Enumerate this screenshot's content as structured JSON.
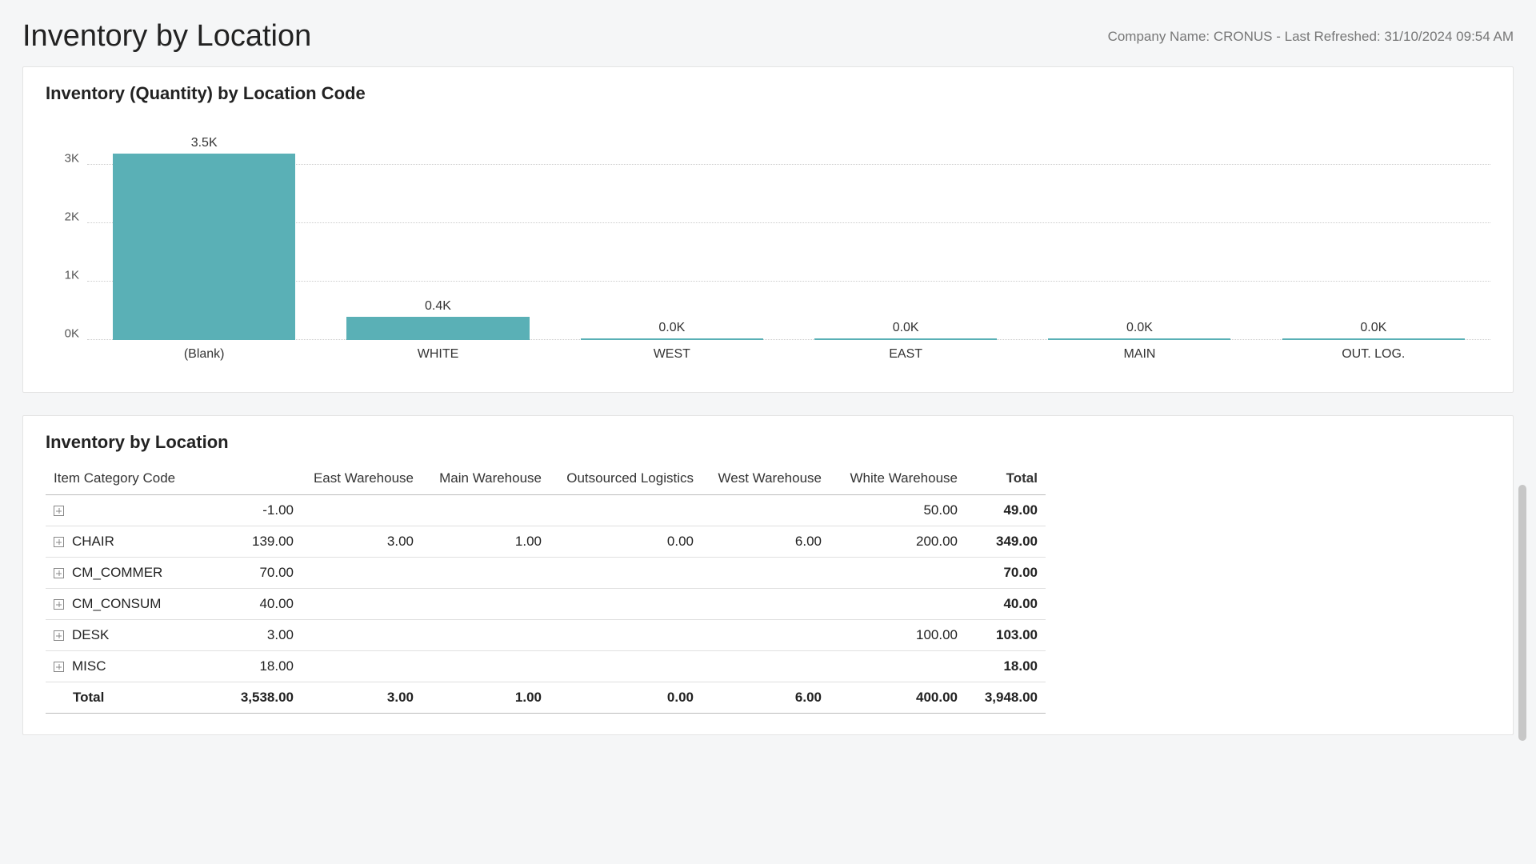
{
  "header": {
    "title": "Inventory by Location",
    "company_line": "Company Name: CRONUS - Last Refreshed: 31/10/2024 09:54 AM"
  },
  "chart": {
    "title": "Inventory (Quantity) by Location Code",
    "y_ticks": [
      "0K",
      "1K",
      "2K",
      "3K"
    ]
  },
  "chart_data": {
    "type": "bar",
    "title": "Inventory (Quantity) by Location Code",
    "xlabel": "",
    "ylabel": "",
    "ylim": [
      0,
      3500
    ],
    "y_ticks": [
      0,
      1000,
      2000,
      3000
    ],
    "categories": [
      "(Blank)",
      "WHITE",
      "WEST",
      "EAST",
      "MAIN",
      "OUT. LOG."
    ],
    "values": [
      3500,
      400,
      0,
      0,
      0,
      0
    ],
    "value_labels": [
      "3.5K",
      "0.4K",
      "0.0K",
      "0.0K",
      "0.0K",
      "0.0K"
    ]
  },
  "matrix": {
    "title": "Inventory by Location",
    "columns": [
      "Item Category Code",
      "",
      "East Warehouse",
      "Main Warehouse",
      "Outsourced Logistics",
      "West Warehouse",
      "White Warehouse",
      "Total"
    ],
    "rows": [
      {
        "code": "",
        "blank": "-1.00",
        "east": "",
        "main": "",
        "out": "",
        "west": "",
        "white": "50.00",
        "total": "49.00"
      },
      {
        "code": "CHAIR",
        "blank": "139.00",
        "east": "3.00",
        "main": "1.00",
        "out": "0.00",
        "west": "6.00",
        "white": "200.00",
        "total": "349.00"
      },
      {
        "code": "CM_COMMER",
        "blank": "70.00",
        "east": "",
        "main": "",
        "out": "",
        "west": "",
        "white": "",
        "total": "70.00"
      },
      {
        "code": "CM_CONSUM",
        "blank": "40.00",
        "east": "",
        "main": "",
        "out": "",
        "west": "",
        "white": "",
        "total": "40.00"
      },
      {
        "code": "DESK",
        "blank": "3.00",
        "east": "",
        "main": "",
        "out": "",
        "west": "",
        "white": "100.00",
        "total": "103.00"
      },
      {
        "code": "MISC",
        "blank": "18.00",
        "east": "",
        "main": "",
        "out": "",
        "west": "",
        "white": "",
        "total": "18.00"
      }
    ],
    "totals": {
      "label": "Total",
      "blank": "3,538.00",
      "east": "3.00",
      "main": "1.00",
      "out": "0.00",
      "west": "6.00",
      "white": "400.00",
      "total": "3,948.00"
    }
  }
}
